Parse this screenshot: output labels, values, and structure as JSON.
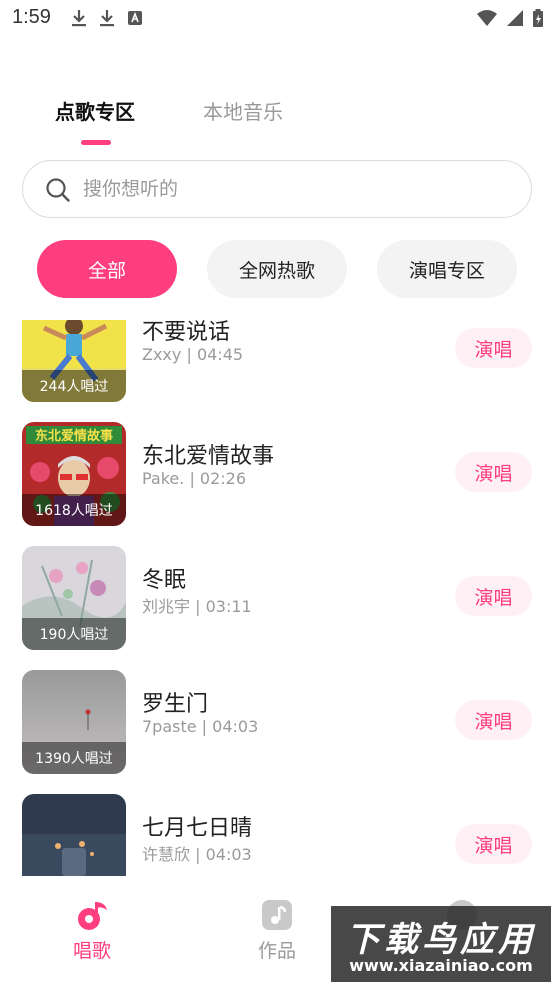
{
  "status_bar": {
    "time": "1:59"
  },
  "top_tabs": [
    {
      "label": "点歌专区",
      "active": true
    },
    {
      "label": "本地音乐",
      "active": false
    }
  ],
  "search": {
    "placeholder": "搜你想听的",
    "value": ""
  },
  "categories": [
    {
      "label": "全部",
      "active": true
    },
    {
      "label": "全网热歌",
      "active": false
    },
    {
      "label": "演唱专区",
      "active": false
    }
  ],
  "songs": [
    {
      "title": "不要说话",
      "artist": "Zxxy",
      "duration": "04:45",
      "sung_count": "244人唱过",
      "action": "演唱"
    },
    {
      "title": "东北爱情故事",
      "artist": "Pake.",
      "duration": "02:26",
      "sung_count": "1618人唱过",
      "action": "演唱"
    },
    {
      "title": "冬眠",
      "artist": "刘兆宇",
      "duration": "03:11",
      "sung_count": "190人唱过",
      "action": "演唱"
    },
    {
      "title": "罗生门",
      "artist": "7paste",
      "duration": "04:03",
      "sung_count": "1390人唱过",
      "action": "演唱"
    },
    {
      "title": "七月七日晴",
      "artist": "许慧欣",
      "duration": "04:03",
      "sung_count": "",
      "action": "演唱"
    }
  ],
  "bottom_nav": [
    {
      "label": "唱歌",
      "icon": "music-note-icon",
      "active": true
    },
    {
      "label": "作品",
      "icon": "music-file-icon",
      "active": false
    },
    {
      "label": "",
      "icon": "profile-icon",
      "active": false
    }
  ],
  "watermark": {
    "main": "下载鸟应用",
    "sub": "www.xiazainiao.com"
  },
  "colors": {
    "accent": "#ff3e7f",
    "accent_light": "#fff0f5",
    "muted_text": "#9a9a9a",
    "pill_bg": "#f3f3f3"
  }
}
